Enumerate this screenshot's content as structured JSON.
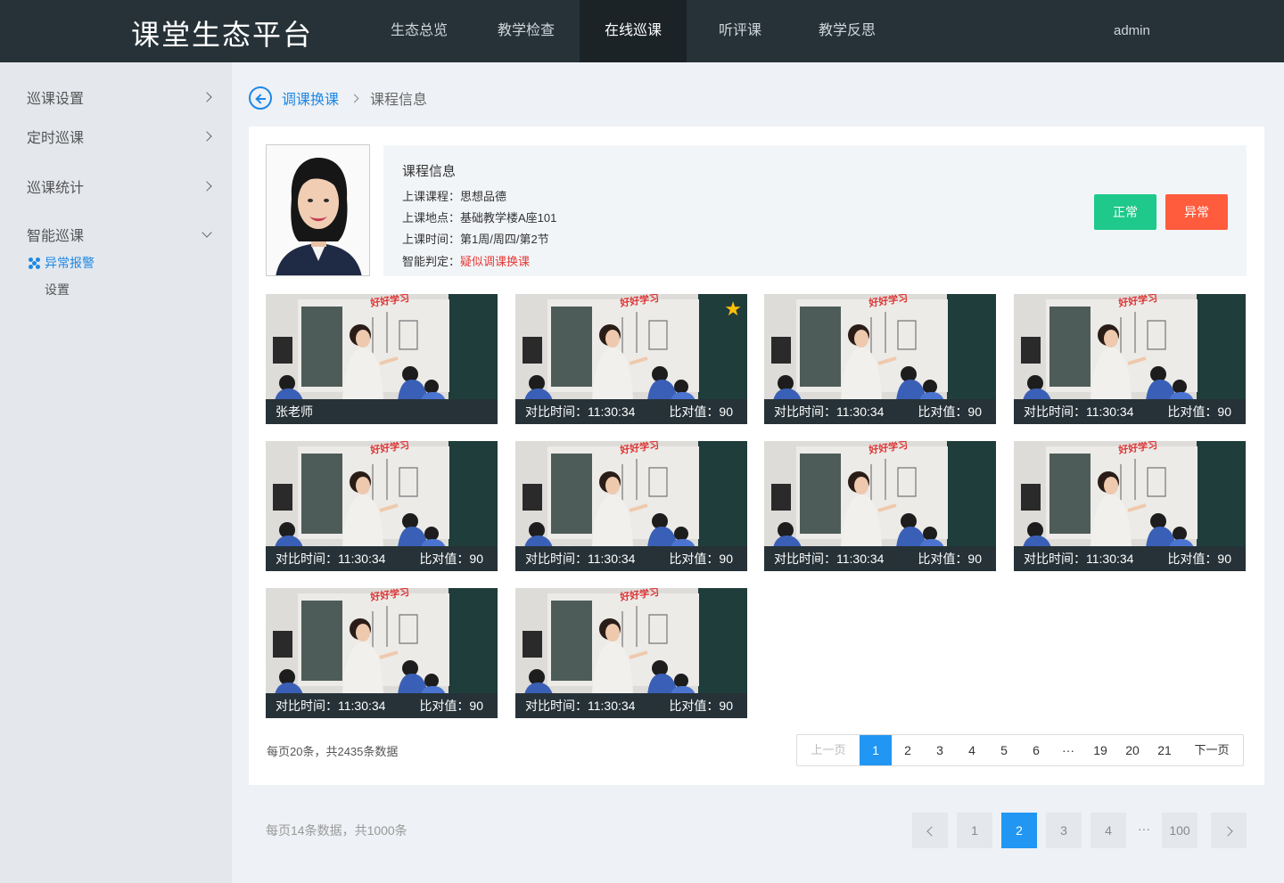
{
  "header": {
    "title": "课堂生态平台",
    "nav": [
      "生态总览",
      "教学检查",
      "在线巡课",
      "听评课",
      "教学反思"
    ],
    "active_nav": 2,
    "user": "admin"
  },
  "sidebar": {
    "items": [
      {
        "label": "巡课设置",
        "chevron": "chevron-right"
      },
      {
        "label": "定时巡课",
        "chevron": "chevron-right"
      },
      {
        "label": "巡课统计",
        "chevron": "chevron-right"
      },
      {
        "label": "智能巡课",
        "chevron": "chevron-down"
      }
    ],
    "sub_active": "异常报警",
    "sub_item": "设置"
  },
  "breadcrumb": {
    "link": "调课换课",
    "current": "课程信息"
  },
  "course": {
    "title": "课程信息",
    "lines": [
      {
        "label": "上课课程：",
        "value": "思想品德"
      },
      {
        "label": "上课地点：",
        "value": "基础教学楼A座101"
      },
      {
        "label": "上课时间：",
        "value": "第1周/周四/第2节"
      },
      {
        "label": "智能判定：",
        "value": "疑似调课换课"
      }
    ],
    "btn_normal": "正常",
    "btn_abnormal": "异常"
  },
  "thumbnails": [
    {
      "caption_left": "张老师",
      "caption_right": ""
    },
    {
      "caption_left": "对比时间：11:30:34",
      "caption_right": "比对值：90",
      "starred": true
    },
    {
      "caption_left": "对比时间：11:30:34",
      "caption_right": "比对值：90"
    },
    {
      "caption_left": "对比时间：11:30:34",
      "caption_right": "比对值：90"
    },
    {
      "caption_left": "对比时间：11:30:34",
      "caption_right": "比对值：90"
    },
    {
      "caption_left": "对比时间：11:30:34",
      "caption_right": "比对值：90"
    },
    {
      "caption_left": "对比时间：11:30:34",
      "caption_right": "比对值：90"
    },
    {
      "caption_left": "对比时间：11:30:34",
      "caption_right": "比对值：90"
    },
    {
      "caption_left": "对比时间：11:30:34",
      "caption_right": "比对值：90"
    },
    {
      "caption_left": "对比时间：11:30:34",
      "caption_right": "比对值：90"
    }
  ],
  "banner_text": "好好学习",
  "pager": {
    "note": "每页20条，共2435条数据",
    "prev": "上一页",
    "pages": [
      "1",
      "2",
      "3",
      "4",
      "5",
      "6",
      "···",
      "19",
      "20",
      "21"
    ],
    "active": "1",
    "next": "下一页"
  },
  "footer_pager": {
    "note": "每页14条数据，共1000条",
    "pages": [
      "1",
      "2",
      "3",
      "4",
      "···",
      "100"
    ],
    "active": "2"
  },
  "colors": {
    "header_bg": "#263238",
    "accent": "#2196f3",
    "normal_btn": "#1ec98b",
    "abnormal_btn": "#ff5b3d",
    "warning_text": "#e53935"
  }
}
